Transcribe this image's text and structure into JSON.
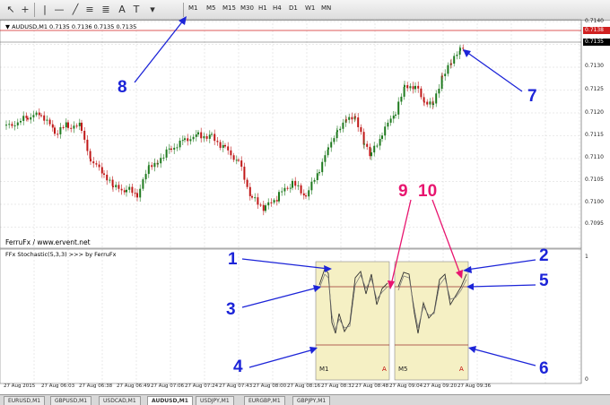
{
  "toolbar": {
    "timeframes": [
      "M1",
      "M5",
      "M15",
      "M30",
      "H1",
      "H4",
      "D1",
      "W1",
      "MN"
    ],
    "icons": [
      "cursor-icon",
      "crosshair-icon",
      "vertical-line-icon",
      "horizontal-line-icon",
      "trendline-icon",
      "channel-icon",
      "fibonacci-icon",
      "text-icon",
      "label-icon",
      "arrow-tool-icon"
    ],
    "text_tool_label": "A",
    "label_tool_label": "T"
  },
  "chart": {
    "header": "▼ AUDUSD,M1  0.7135 0.7136 0.7135 0.7135",
    "footer": "FerruFx / www.ervent.net",
    "price_labels": [
      "0.7140",
      "0.7135",
      "0.7130",
      "0.7125",
      "0.7120",
      "0.7115",
      "0.7110",
      "0.7105",
      "0.7100",
      "0.7095"
    ],
    "red_price_box": "0.7138",
    "black_price_box": "0.7135",
    "time_labels": [
      "27 Aug 2015",
      "27 Aug 06:03",
      "27 Aug 06:38",
      "27 Aug 06:49",
      "27 Aug 07:06",
      "27 Aug 07:24",
      "27 Aug 07:43",
      "27 Aug 08:00",
      "27 Aug 08:16",
      "27 Aug 08:32",
      "27 Aug 08:48",
      "27 Aug 09:04",
      "27 Aug 09:20",
      "27 Aug 09:36"
    ]
  },
  "indicator": {
    "title": "FFx Stochastic(5,3,3) >>> by FerruFx",
    "scale_top": "1",
    "scale_bottom": "0",
    "panels": [
      {
        "timeframe": "M1",
        "marker": "A"
      },
      {
        "timeframe": "M5",
        "marker": "A"
      }
    ]
  },
  "callouts": {
    "blue": [
      "1",
      "2",
      "3",
      "4",
      "5",
      "6",
      "7",
      "8"
    ],
    "pink": [
      "9",
      "10"
    ]
  },
  "tabs": [
    "EURUSD,M1",
    "GBPUSD,M1",
    "USDCAD,M1",
    "AUDUSD,M1",
    "USDJPY,M1",
    "EURGBP,M1",
    "GBPJPY,M1"
  ],
  "active_tab": "AUDUSD,M1",
  "colors": {
    "bull_candle": "#1f7a1f",
    "bear_candle": "#c01818",
    "callout_blue": "#1c24d8",
    "callout_pink": "#e8156f",
    "panel_fill": "#f5f0c4",
    "level_line": "#9a3030"
  }
}
